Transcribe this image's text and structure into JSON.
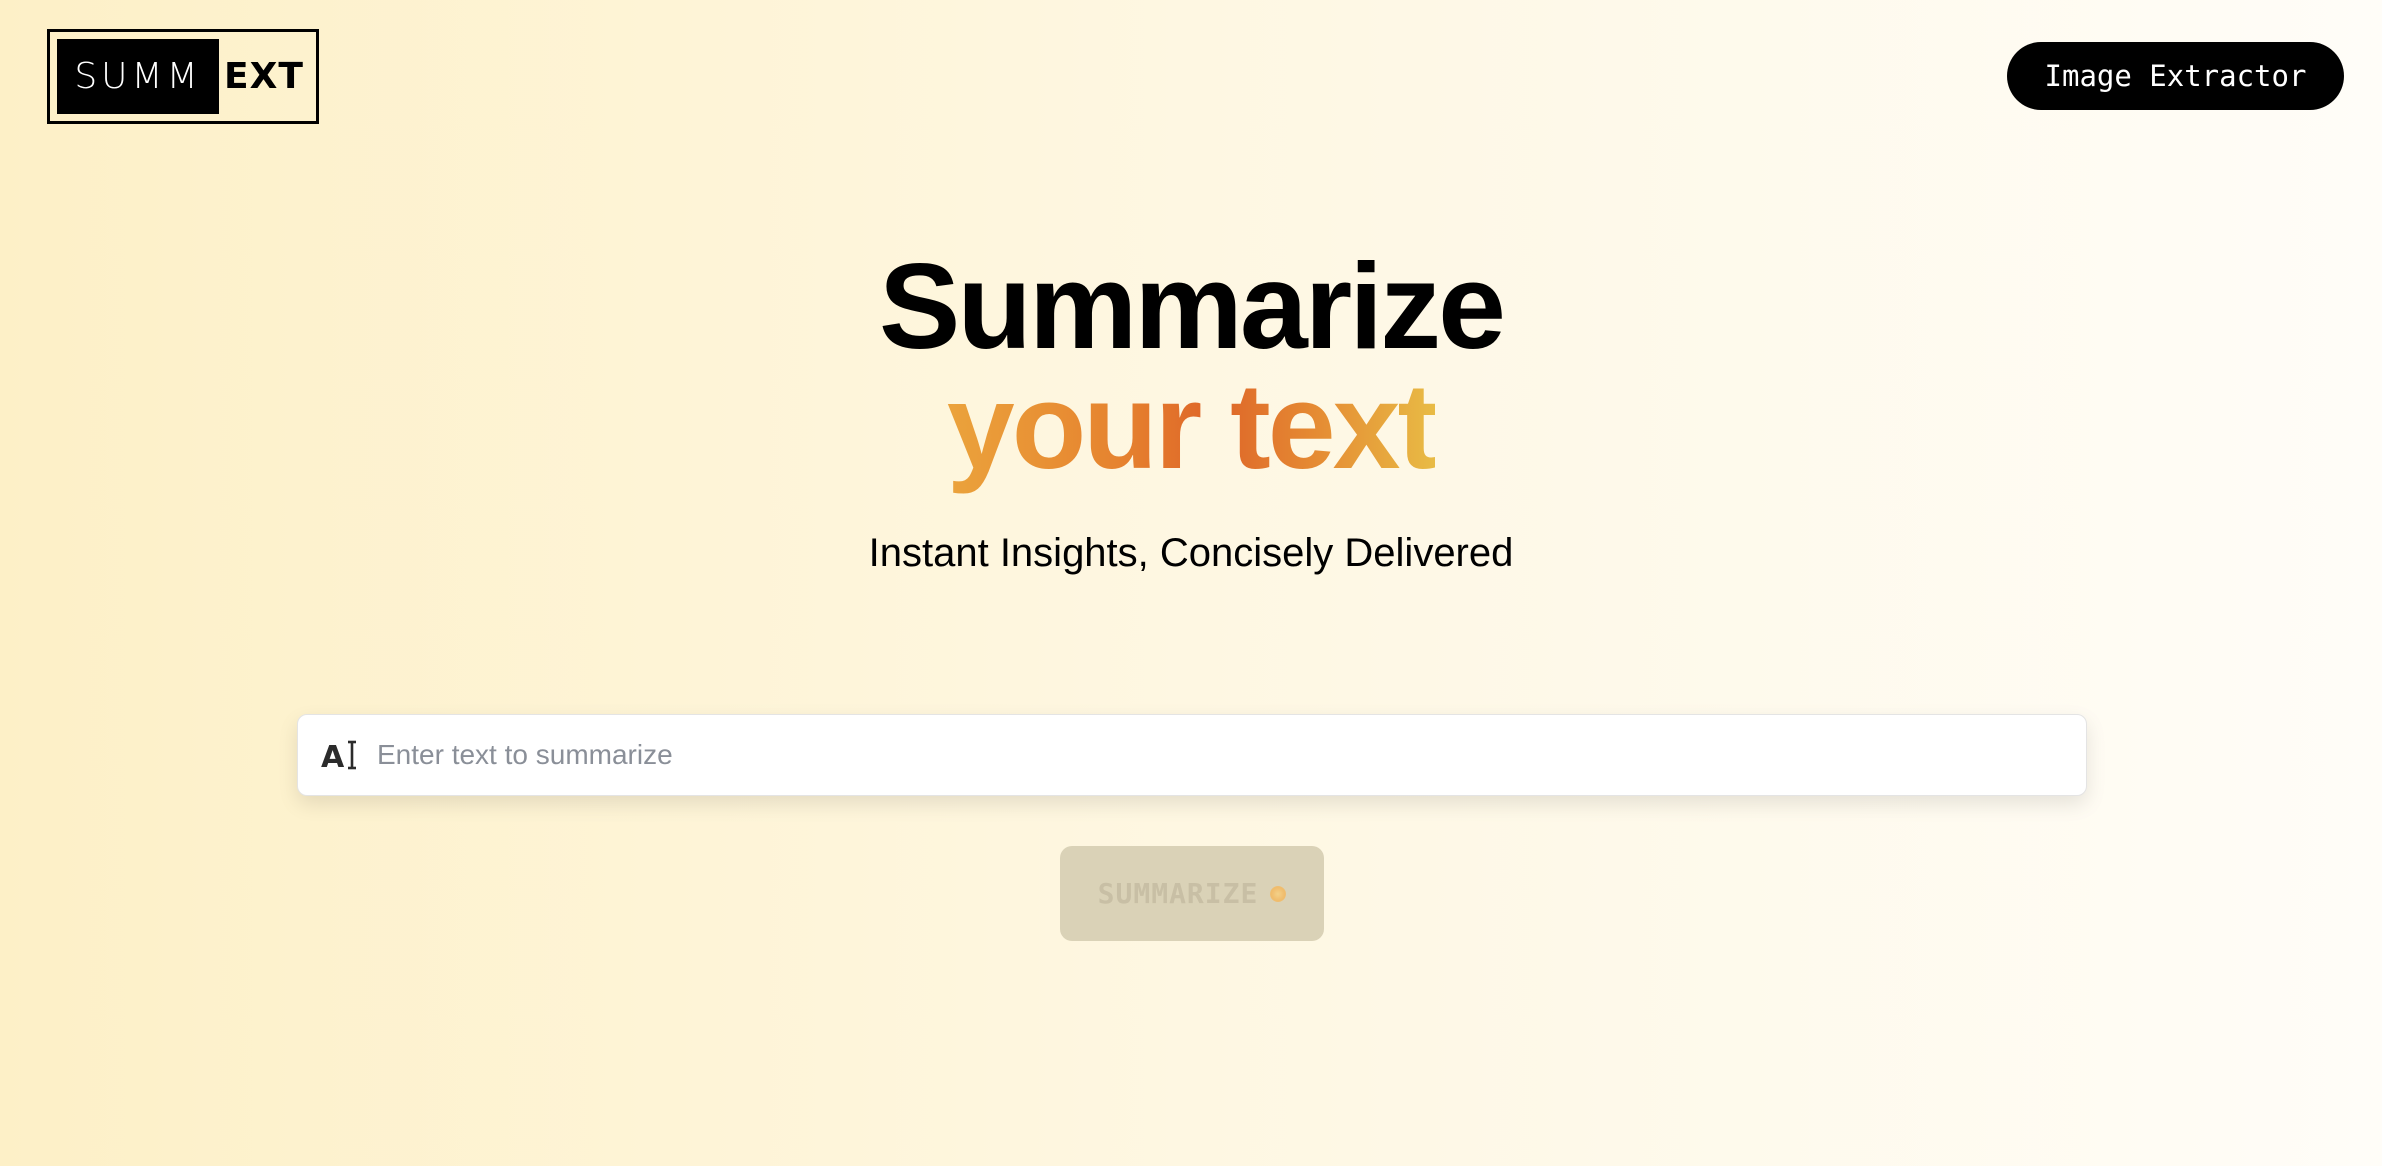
{
  "logo": {
    "left_text": "SUMM",
    "right_text": "EXT"
  },
  "nav": {
    "image_extractor_label": "Image Extractor"
  },
  "hero": {
    "title": "Summarize",
    "accent": "your text",
    "tagline": "Instant Insights, Concisely Delivered"
  },
  "form": {
    "input_placeholder": "Enter text to summarize",
    "input_value": "",
    "input_icon": "text-cursor-icon",
    "submit_label": "SUMMARIZE",
    "submit_icon": "sparkle-icon",
    "submit_state": "disabled"
  },
  "colors": {
    "accent_gradient": [
      "#eba33c",
      "#de6528",
      "#e8bb45"
    ],
    "background": [
      "#fdf0c7",
      "#fffdf8"
    ],
    "nav_button_bg": "#000000",
    "submit_disabled_bg": "#d9d1b5"
  }
}
